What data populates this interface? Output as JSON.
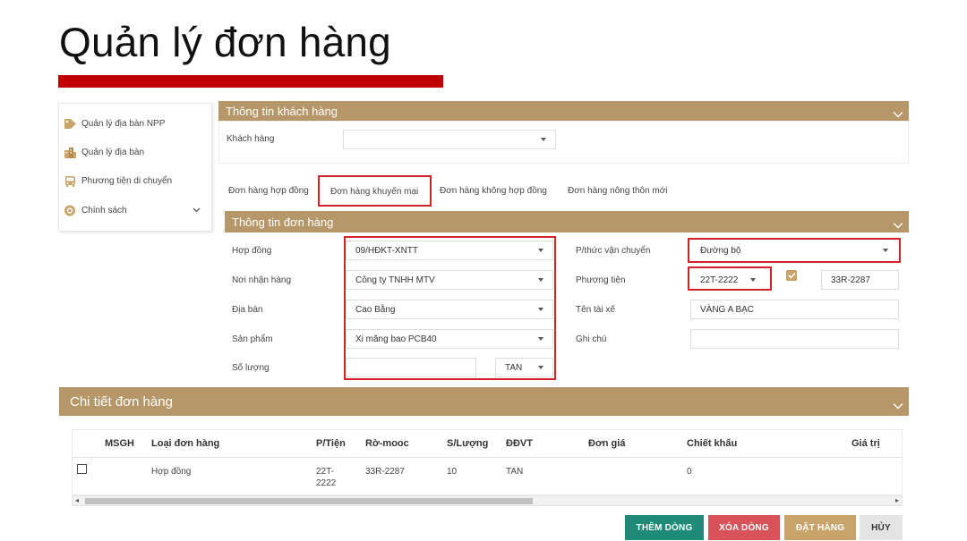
{
  "slide": {
    "title": "Quản lý đơn hàng"
  },
  "sidebar": {
    "items": [
      {
        "label": "Quản lý địa bàn NPP"
      },
      {
        "label": "Quản lý địa bàn"
      },
      {
        "label": "Phương tiện di chuyển"
      },
      {
        "label": "Chính sách"
      }
    ]
  },
  "customer_panel": {
    "title": "Thông tin khách hàng",
    "customer_label": "Khách hàng",
    "customer_value": ""
  },
  "tabs": [
    {
      "label": "Đơn hàng hợp đồng"
    },
    {
      "label": "Đơn hàng khuyến mại"
    },
    {
      "label": "Đơn hàng không hợp đồng"
    },
    {
      "label": "Đơn hàng nông thôn mới"
    }
  ],
  "order_panel": {
    "title": "Thông tin đơn hàng",
    "contract": {
      "label": "Hợp đồng",
      "value": "09/HĐKT-XNTT"
    },
    "receiver": {
      "label": "Nơi nhận hàng",
      "value": "Công ty TNHH MTV"
    },
    "area": {
      "label": "Địa bàn",
      "value": "Cao Bằng"
    },
    "product": {
      "label": "Sản phẩm",
      "value": "Xi măng bao PCB40"
    },
    "quantity": {
      "label": "Số lượng",
      "value": "",
      "unit": "TAN"
    },
    "transport_method": {
      "label": "P/thức vận chuyển",
      "value": "Đường bộ"
    },
    "vehicle": {
      "label": "Phương tiện",
      "value": "22T-2222",
      "checked": true,
      "trailer": "33R-2287"
    },
    "driver": {
      "label": "Tên tài xế",
      "value": "VÀNG A BẠC"
    },
    "note": {
      "label": "Ghi chú",
      "value": ""
    }
  },
  "detail_panel": {
    "title": "Chi tiết đơn hàng",
    "columns": [
      "MSGH",
      "Loại đơn hàng",
      "P/Tiện",
      "Rờ-mooc",
      "S/Lượng",
      "ĐĐVT",
      "Đơn giá",
      "Chiết khấu",
      "Giá trị"
    ],
    "rows": [
      {
        "msgh": "",
        "type": "Hợp đồng",
        "vehicle": "22T-2222",
        "trailer": "33R-2287",
        "qty": "10",
        "unit": "TAN",
        "price": "",
        "discount": "0",
        "value": ""
      }
    ]
  },
  "buttons": {
    "add": "THÊM DÒNG",
    "delete": "XÓA DÒNG",
    "order": "ĐẶT HÀNG",
    "cancel": "HỦY"
  },
  "colors": {
    "panel_header": "#b5976a",
    "accent_red": "#c00000",
    "highlight_red": "#d2232a",
    "btn_add": "#1e8a78",
    "btn_delete": "#d8525a",
    "btn_order": "#c9a46a",
    "btn_cancel": "#e4e4e4"
  }
}
